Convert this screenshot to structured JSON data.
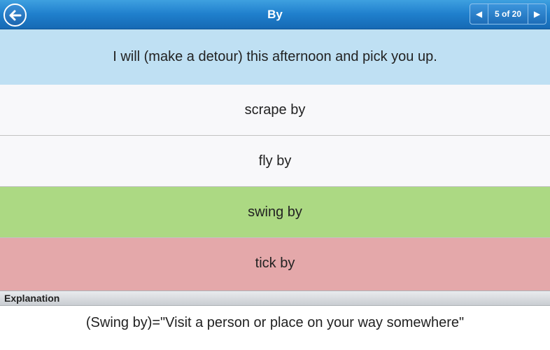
{
  "header": {
    "title": "By",
    "back_icon": "back-arrow-icon",
    "pager": {
      "label": "5 of 20",
      "prev_icon": "prev-arrow-icon",
      "next_icon": "next-arrow-icon"
    }
  },
  "question": {
    "text": "I will (make a detour) this afternoon and pick you up."
  },
  "options": [
    {
      "label": "scrape by",
      "state": "neutral"
    },
    {
      "label": "fly by",
      "state": "neutral"
    },
    {
      "label": "swing by",
      "state": "correct"
    },
    {
      "label": "tick by",
      "state": "wrong"
    }
  ],
  "explanation": {
    "header": "Explanation",
    "text": "(Swing by)=\"Visit a person or place on your way somewhere\""
  },
  "colors": {
    "header_blue": "#1f7fcc",
    "question_bg": "#bfe0f3",
    "correct_bg": "#acd983",
    "wrong_bg": "#e4a8aa"
  }
}
